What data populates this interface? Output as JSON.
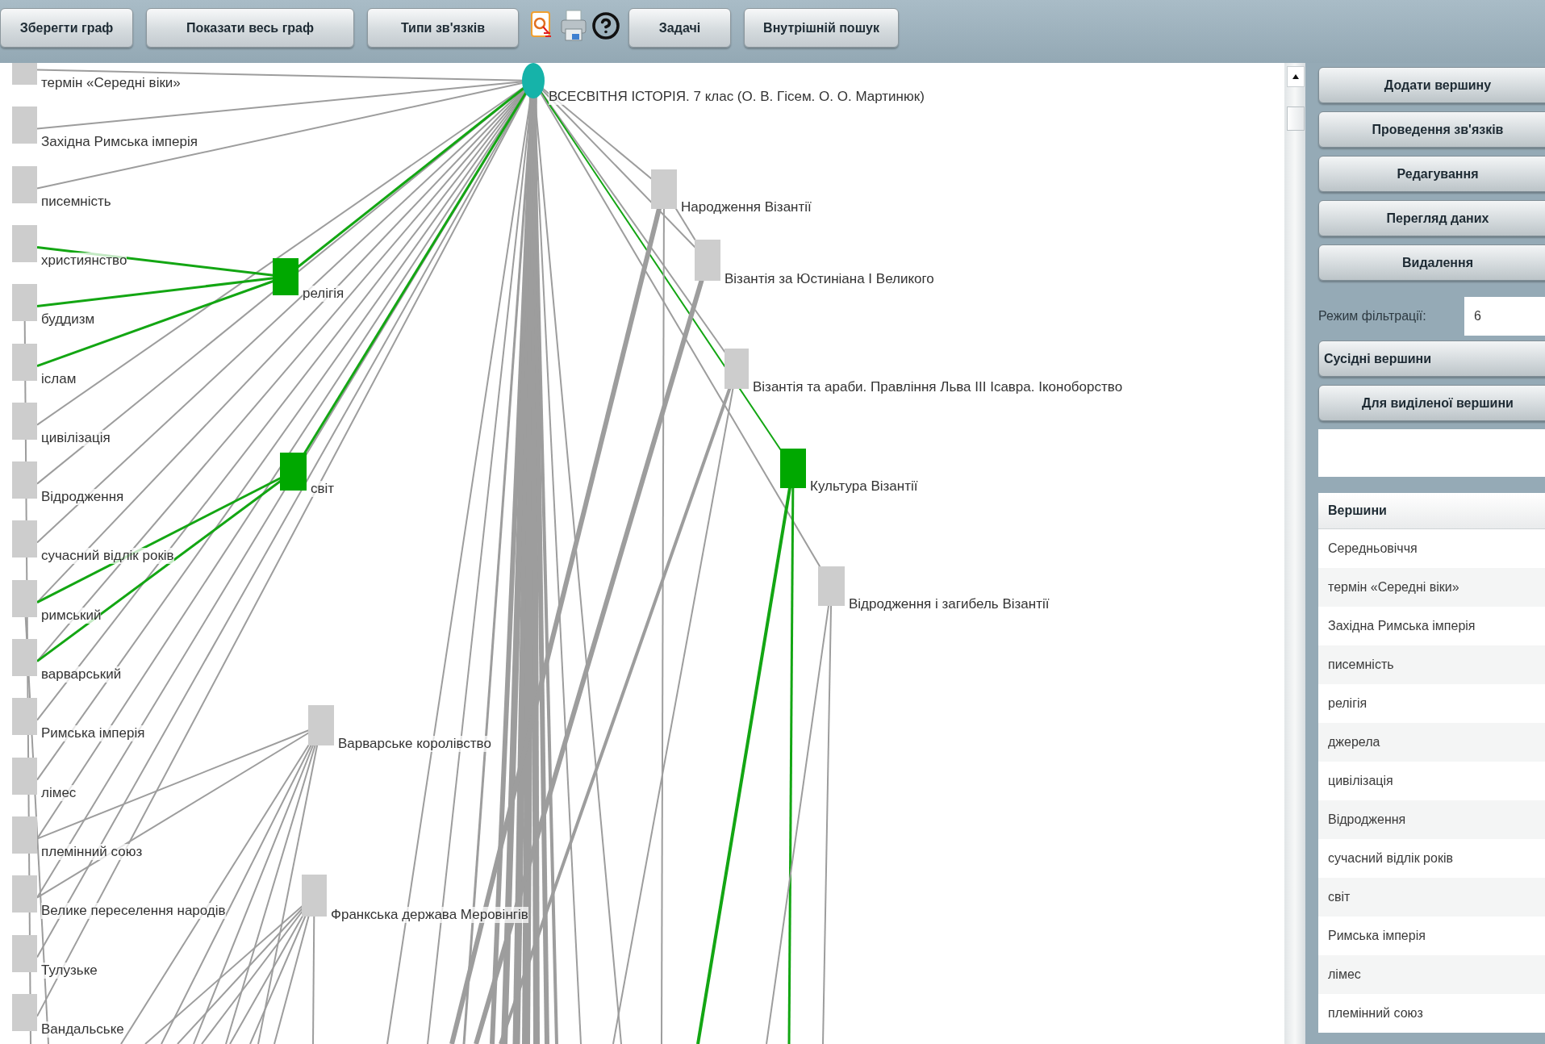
{
  "toolbar": {
    "buttons": [
      {
        "kind": "text",
        "label": "Зберегти граф"
      },
      {
        "kind": "text",
        "label": "Показати весь граф"
      },
      {
        "kind": "text",
        "label": "Типи зв'язків"
      },
      {
        "kind": "find"
      },
      {
        "kind": "print"
      },
      {
        "kind": "help"
      },
      {
        "kind": "text",
        "label": "Задачі"
      },
      {
        "kind": "text",
        "label": "Внутрішній пошук"
      }
    ]
  },
  "graph": {
    "nodes": [
      {
        "label": "термін «Середні віки»",
        "kind": "topic",
        "highlighted": false
      },
      {
        "label": "Західна Римська імперія",
        "kind": "topic",
        "highlighted": false
      },
      {
        "label": "писемність",
        "kind": "topic",
        "highlighted": false
      },
      {
        "label": "християнство",
        "kind": "topic",
        "highlighted": false
      },
      {
        "label": "буддизм",
        "kind": "topic",
        "highlighted": false
      },
      {
        "label": "іслам",
        "kind": "topic",
        "highlighted": false
      },
      {
        "label": "цивілізація",
        "kind": "topic",
        "highlighted": false
      },
      {
        "label": "Відродження",
        "kind": "topic",
        "highlighted": false
      },
      {
        "label": "сучасний відлік років",
        "kind": "topic",
        "highlighted": false
      },
      {
        "label": "римський",
        "kind": "topic",
        "highlighted": false
      },
      {
        "label": "варварський",
        "kind": "topic",
        "highlighted": false
      },
      {
        "label": "Римська імперія",
        "kind": "topic",
        "highlighted": false
      },
      {
        "label": "лімес",
        "kind": "topic",
        "highlighted": false
      },
      {
        "label": "племінний союз",
        "kind": "topic",
        "highlighted": false
      },
      {
        "label": "Велике переселення народів",
        "kind": "topic",
        "highlighted": false
      },
      {
        "label": "Тулузьке",
        "kind": "topic",
        "highlighted": false
      },
      {
        "label": "Вандальське",
        "kind": "topic",
        "highlighted": false
      },
      {
        "label": "ВСЕСВІТНЯ ІСТОРІЯ. 7 клас (О. В. Гісем. О. О. Мартинюк)",
        "kind": "root",
        "highlighted": false
      },
      {
        "label": "релігія",
        "kind": "topic",
        "highlighted": true
      },
      {
        "label": "світ",
        "kind": "topic",
        "highlighted": true
      },
      {
        "label": "Народження Візантії",
        "kind": "topic",
        "highlighted": false
      },
      {
        "label": "Візантія за Юстиніана I Великого",
        "kind": "topic",
        "highlighted": false
      },
      {
        "label": "Візантія та араби. Правління Льва III Ісавра. Іконоборство",
        "kind": "topic",
        "highlighted": false
      },
      {
        "label": "Культура Візантії",
        "kind": "topic",
        "highlighted": true
      },
      {
        "label": "Відродження і загибель Візантії",
        "kind": "topic",
        "highlighted": false
      },
      {
        "label": "Варварське королівство",
        "kind": "topic",
        "highlighted": false
      },
      {
        "label": "Франкська держава Меровінгів",
        "kind": "topic",
        "highlighted": false
      }
    ]
  },
  "panel": {
    "actions": [
      "Додати вершину",
      "Проведення зв'язків",
      "Редагування",
      "Перегляд даних",
      "Видалення"
    ],
    "filter": {
      "label": "Режим фільтрації:",
      "value": "6"
    },
    "filter_buttons": [
      {
        "kind": "dropdown",
        "label": "Сусідні вершини"
      },
      {
        "kind": "button",
        "label": "Для виділеної вершини"
      }
    ],
    "vertex_list": {
      "header": "Вершини",
      "rows": [
        "Середньовіччя",
        "термін «Середні віки»",
        "Західна Римська імперія",
        "писемність",
        "релігія",
        "джерела",
        "цивілізація",
        "Відродження",
        "сучасний відлік років",
        "світ",
        "Римська імперія",
        "лімес",
        "племінний союз"
      ]
    }
  }
}
